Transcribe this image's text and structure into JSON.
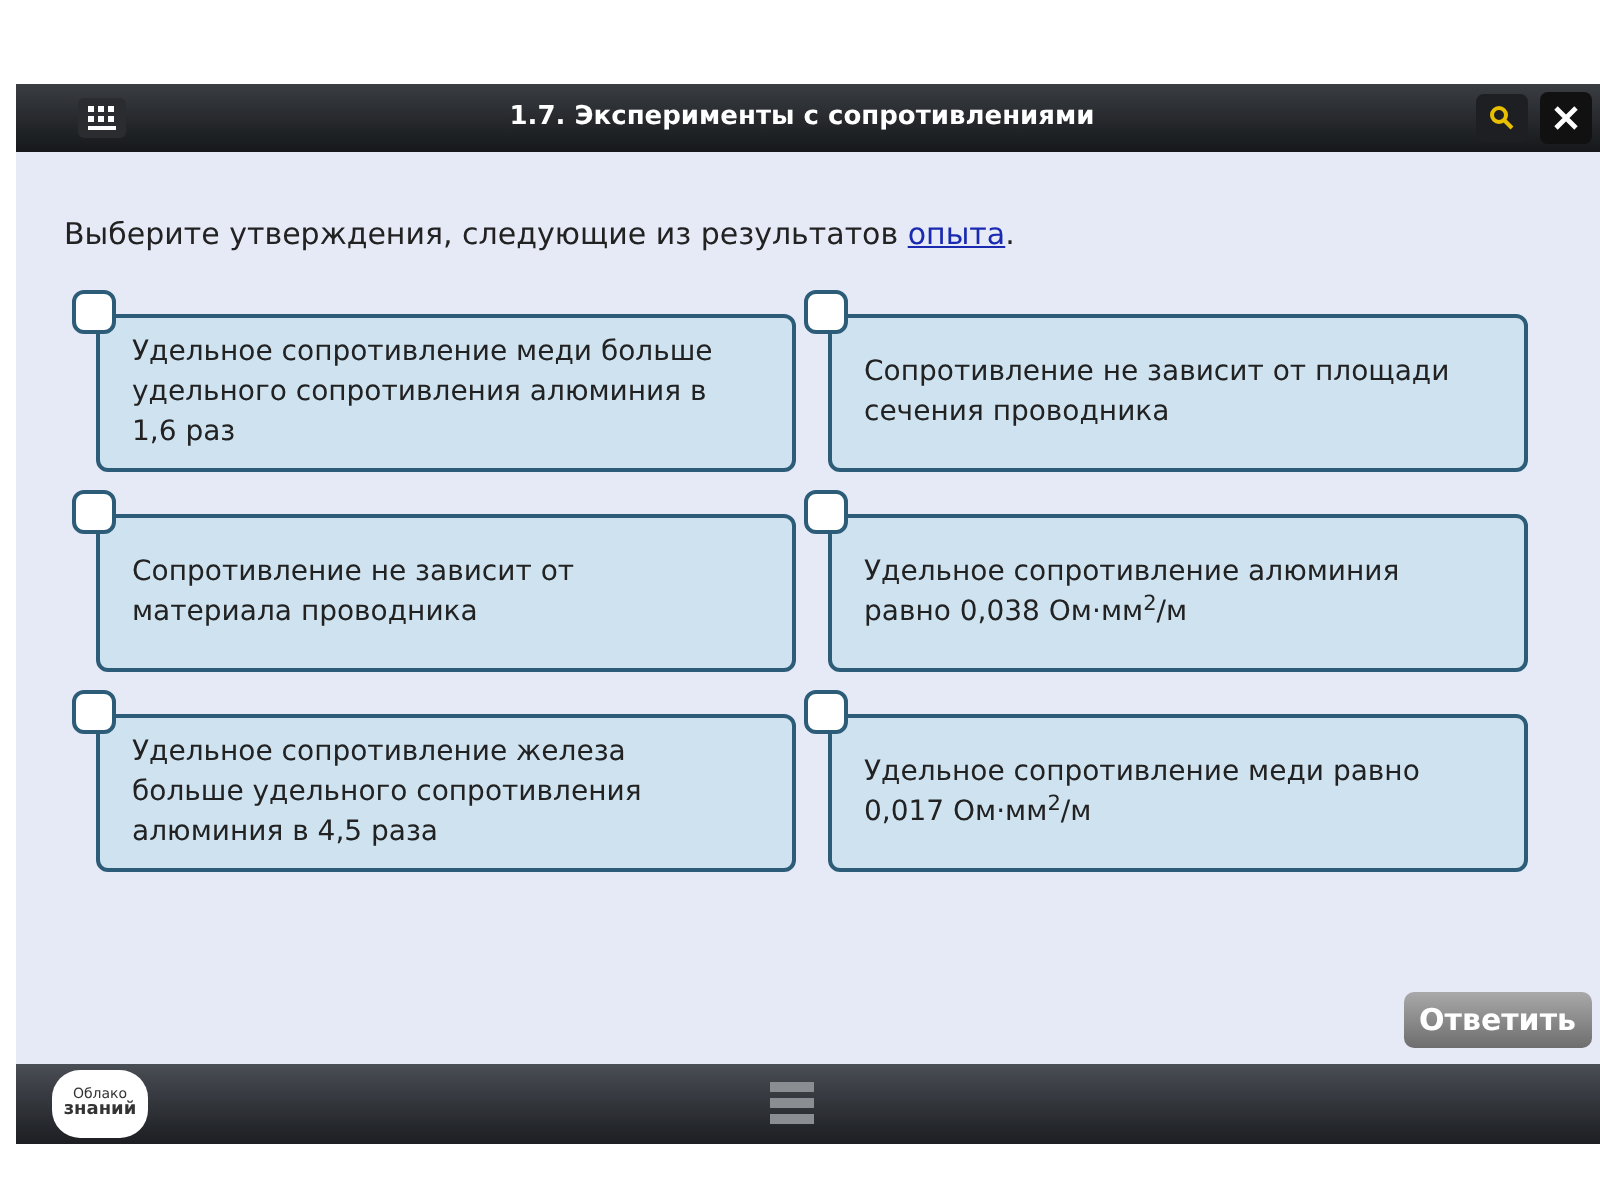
{
  "window": {
    "title": "1.7. Эксперименты с сопротивлениями"
  },
  "prompt": {
    "text": "Выберите утверждения, следующие из результатов",
    "link": "опыта",
    "end": "."
  },
  "options": [
    {
      "text": "Удельное сопротивление меди больше удельного сопротивления алюминия в 1,6 раз",
      "checked": false
    },
    {
      "text": "Сопротивление не зависит от площади сечения проводника",
      "checked": false
    },
    {
      "text": "Сопротивление не зависит от материала проводника",
      "checked": false
    },
    {
      "text": "Удельное сопротивление алюминия равно 0,038 Ом·мм$^{2}$/м",
      "checked": false
    },
    {
      "text": "Удельное сопротивление железа больше удельного сопротивления алюминия в 4,5 раза",
      "checked": false
    },
    {
      "text": "Удельное сопротивление меди равно 0,017 Ом·мм$^{2}$/м",
      "checked": false
    }
  ],
  "answer_button": "Ответить",
  "logo": {
    "line1": "Облако",
    "line2": "знаний"
  }
}
